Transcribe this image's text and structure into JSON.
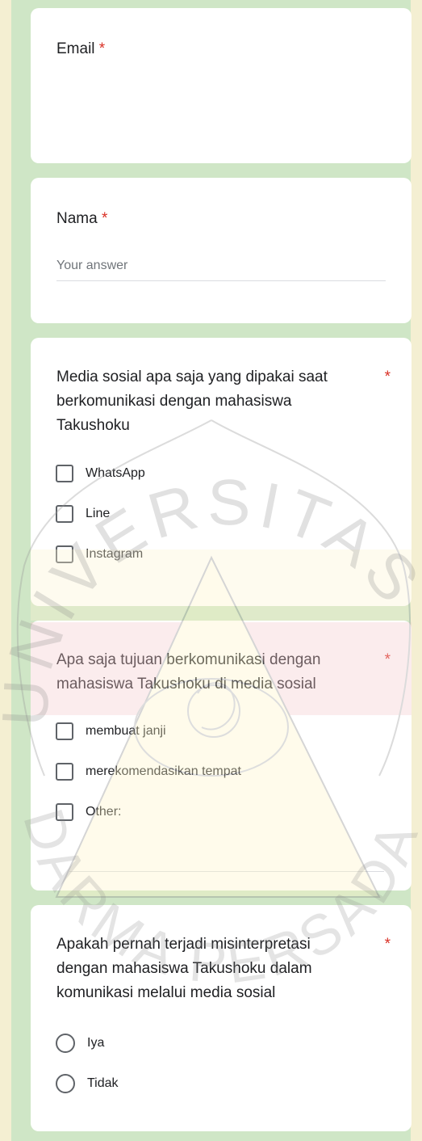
{
  "questions": {
    "email": {
      "label": "Email",
      "required_mark": "*"
    },
    "nama": {
      "label": "Nama",
      "required_mark": "*",
      "placeholder": "Your answer"
    },
    "media": {
      "label": "Media sosial apa saja yang dipakai saat berkomunikasi dengan mahasiswa Takushoku",
      "required_mark": "*",
      "options": [
        "WhatsApp",
        "Line",
        "Instagram"
      ]
    },
    "tujuan": {
      "label": "Apa saja tujuan berkomunikasi dengan mahasiswa Takushoku di media sosial",
      "required_mark": "*",
      "options": [
        "membuat janji",
        "merekomendasikan tempat",
        "Other:"
      ]
    },
    "misinterpretasi": {
      "label": "Apakah pernah terjadi misinterpretasi dengan mahasiswa Takushoku dalam komunikasi melalui media sosial",
      "required_mark": "*",
      "options": [
        "Iya",
        "Tidak"
      ]
    }
  },
  "colors": {
    "background": "#cfe6c6",
    "required": "#d93025",
    "text": "#202124"
  },
  "watermark": {
    "text_top": "UNIVERSITAS",
    "text_bottom": "DARMA PERSADA"
  }
}
